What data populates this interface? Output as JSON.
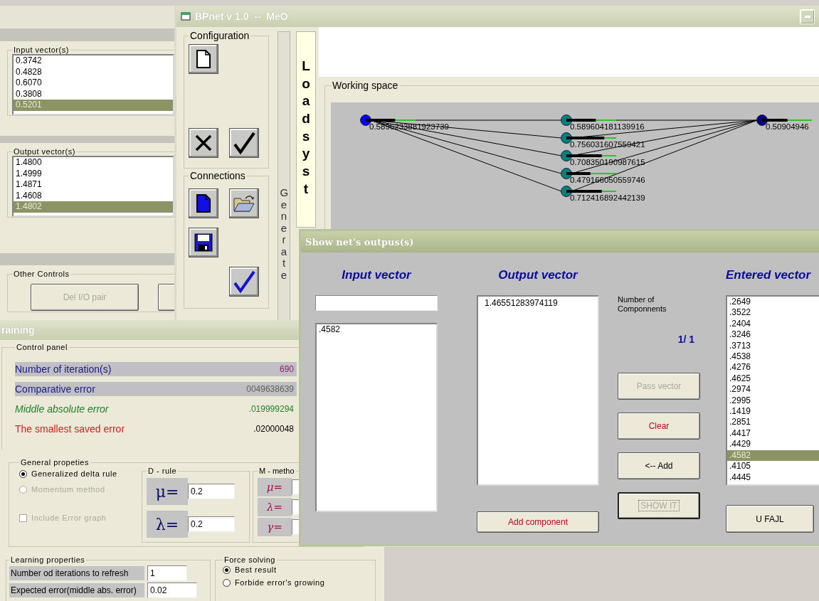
{
  "io_window": {
    "input_group": {
      "label": "Input vector(s)",
      "items": [
        {
          "text": "0.3742",
          "selected": false
        },
        {
          "text": "0.4828",
          "selected": false
        },
        {
          "text": "0.6070",
          "selected": false
        },
        {
          "text": "0.3808",
          "selected": false
        },
        {
          "text": "0.5201",
          "selected": true
        }
      ]
    },
    "output_group": {
      "label": "Output vector(s)",
      "items": [
        {
          "text": "1.4800",
          "selected": false
        },
        {
          "text": "1.4999",
          "selected": false
        },
        {
          "text": "1.4871",
          "selected": false
        },
        {
          "text": "1.4608",
          "selected": false
        },
        {
          "text": "1.4802",
          "selected": true
        }
      ]
    },
    "other_controls": {
      "label": "Other Controls",
      "buttons": [
        {
          "label": "Del I/O pair",
          "disabled": true
        }
      ]
    }
  },
  "main_window": {
    "title": "BPnet v 1.0  --  MeO",
    "configuration": {
      "label": "Configuration"
    },
    "connections": {
      "label": "Connections"
    },
    "generate_label": "Generate",
    "load_label": "Load syst",
    "working_space": {
      "label": "Working space",
      "nodes": [
        {
          "kind": "input",
          "value": "0.5896233881923739",
          "level": 0.59
        },
        {
          "kind": "hidden",
          "value": "0.589604181139916",
          "level": 0.59
        },
        {
          "kind": "hidden",
          "value": "0.756031607559421",
          "level": 0.76
        },
        {
          "kind": "hidden",
          "value": "0.708350190987615",
          "level": 0.71
        },
        {
          "kind": "hidden",
          "value": "0.479166050559746",
          "level": 0.48
        },
        {
          "kind": "hidden",
          "value": "0.712416892442139",
          "level": 0.71
        },
        {
          "kind": "output",
          "value": "0.50904946",
          "level": 0.51
        }
      ]
    }
  },
  "training_window": {
    "title": "raining",
    "control_panel": {
      "label": "Control panel",
      "rows": [
        {
          "kind": "iterations",
          "label": "Number of iteration(s)",
          "value": "690"
        },
        {
          "kind": "comparative",
          "label": "Comparative error",
          "value": "0049638639"
        },
        {
          "kind": "middle",
          "label": "Middle absolute error",
          "value": ".019999294"
        },
        {
          "kind": "smallest",
          "label": "The smallest saved error",
          "value": ".02000048"
        }
      ]
    },
    "general_properties": {
      "label": "General propeties",
      "options": [
        {
          "label": "Generalized delta rule",
          "selected": true,
          "disabled": false
        },
        {
          "label": "Momentum method",
          "selected": false,
          "disabled": true
        }
      ],
      "checkbox": {
        "label": "Include Error graph",
        "checked": false,
        "disabled": true
      },
      "d_rule": {
        "label": "D - rule",
        "params": [
          {
            "symbol": "μ=",
            "value": "0.2"
          },
          {
            "symbol": "λ=",
            "value": "0.2"
          }
        ]
      },
      "m_method": {
        "label": "M - metho",
        "params": [
          {
            "symbol": "μ="
          },
          {
            "symbol": "λ="
          },
          {
            "symbol": "γ="
          }
        ]
      }
    },
    "learning_properties": {
      "label": "Learning properties",
      "fields": [
        {
          "label": "Number od iterations to refresh",
          "value": "1"
        },
        {
          "label": "Expected error(middle abs. error)",
          "value": "0.02"
        }
      ]
    },
    "force_solving": {
      "label": "Force solving",
      "options": [
        {
          "label": "Best result",
          "selected": true
        },
        {
          "label": "Forbide error's growing",
          "selected": false
        }
      ]
    }
  },
  "dialog": {
    "title": "Show net's outpus(s)",
    "input_heading": "Input vector",
    "output_heading": "Output vector",
    "entered_heading": "Entered vector",
    "input_list": [
      ".4582"
    ],
    "output_list": [
      "1.46551283974119"
    ],
    "components_label": "Number of Componnents",
    "components_count": "1/ 1",
    "add_component_button": {
      "label": "Add component",
      "kind": "danger"
    },
    "buttons": [
      {
        "label": "Pass vector",
        "kind": "disabled"
      },
      {
        "label": "Clear",
        "kind": "danger"
      },
      {
        "label": "<-- Add",
        "kind": "normal"
      },
      {
        "label": "SHOW IT",
        "kind": "focused"
      }
    ],
    "file_button": {
      "label": "U FAJL"
    },
    "entered_list": [
      {
        "text": ".2649",
        "selected": false
      },
      {
        "text": ".3522",
        "selected": false
      },
      {
        "text": ".2404",
        "selected": false
      },
      {
        "text": ".3246",
        "selected": false
      },
      {
        "text": ".3713",
        "selected": false
      },
      {
        "text": ".4538",
        "selected": false
      },
      {
        "text": ".4276",
        "selected": false
      },
      {
        "text": ".4625",
        "selected": false
      },
      {
        "text": ".2974",
        "selected": false
      },
      {
        "text": ".2995",
        "selected": false
      },
      {
        "text": ".1419",
        "selected": false
      },
      {
        "text": ".2851",
        "selected": false
      },
      {
        "text": ".4417",
        "selected": false
      },
      {
        "text": ".4429",
        "selected": false
      },
      {
        "text": ".4582",
        "selected": true
      },
      {
        "text": ".4105",
        "selected": false
      },
      {
        "text": ".4445",
        "selected": false
      }
    ]
  }
}
